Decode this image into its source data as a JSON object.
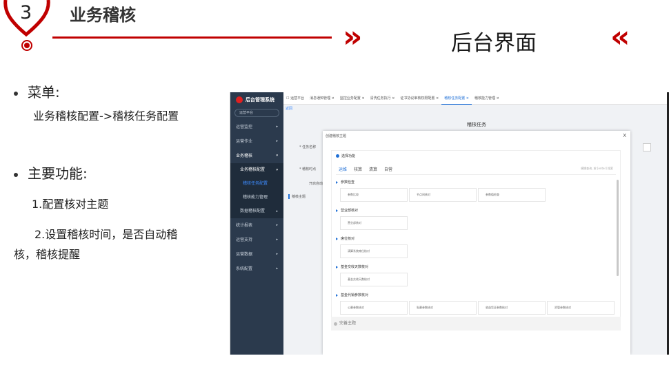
{
  "header": {
    "section_number": "3",
    "section_title": "业务稽核",
    "page_heading": "后台界面",
    "chevron_right": "»",
    "chevron_left": "«",
    "accent_color": "#c00000"
  },
  "content": {
    "menu_label": "菜单:",
    "menu_path": "业务稽核配置->稽核任务配置",
    "functions_label": "主要功能:",
    "item1": "1.配置核对主题",
    "item2_line1": "2.设置稽核时间，是否自动稽",
    "item2_line2": "核，稽核提醒"
  },
  "screenshot": {
    "brand": "后台管理系统",
    "platform": "运营平台",
    "sidebar": [
      {
        "label": "运营监控",
        "arrow": "▸"
      },
      {
        "label": "运营作业",
        "arrow": "▸"
      },
      {
        "label": "业务稽核",
        "arrow": "▾"
      },
      {
        "label": "业务稽核配置",
        "arrow": "▾"
      },
      {
        "label": "稽核任务配置"
      },
      {
        "label": "稽核能力管理"
      },
      {
        "label": "数据稽核配置",
        "arrow": "▸"
      },
      {
        "label": "统计报表",
        "arrow": "▸"
      },
      {
        "label": "运营支持",
        "arrow": "▸"
      },
      {
        "label": "运营数据",
        "arrow": "▸"
      },
      {
        "label": "系统配置",
        "arrow": "▸"
      }
    ],
    "tabs": [
      "☐ 运营平台",
      "消息通知管理 ×",
      "监控业务配置 ×",
      "清洗任务执行 ×",
      "证书协议审核权限配置 ×",
      "稽核任务配置 ×",
      "稽核能力管理 ×"
    ],
    "back": "返回",
    "task_title": "稽核任务",
    "form_task_name": "* 任务名称",
    "form_time": "* 稽核时点",
    "form_auto": "开启自动",
    "form_topic": "稽核主题",
    "modal": {
      "title": "创建稽核主题",
      "close": "X",
      "panel_head": "选择功能",
      "tabs": [
        "运维",
        "核算",
        "清算",
        "自营"
      ],
      "search_hint": "模糊查询, 按 [enter] 搜索",
      "groups": [
        {
          "name": "参数检查",
          "items": [
            "参数比较",
            "节点间核对",
            "参数值检查"
          ]
        },
        {
          "name": "营业部核对",
          "items": [
            "营业部核对"
          ]
        },
        {
          "name": "席位核对",
          "items": [
            "清算系统席位核对"
          ]
        },
        {
          "name": "基金交收天数核对",
          "items": [
            "基金交收天数核对"
          ]
        },
        {
          "name": "基金代销参数核对",
          "items": [
            "公募参数核对",
            "私募参数核对",
            "收益凭证参数核对",
            "资管参数核对"
          ]
        }
      ],
      "footer": "完善主题"
    }
  }
}
